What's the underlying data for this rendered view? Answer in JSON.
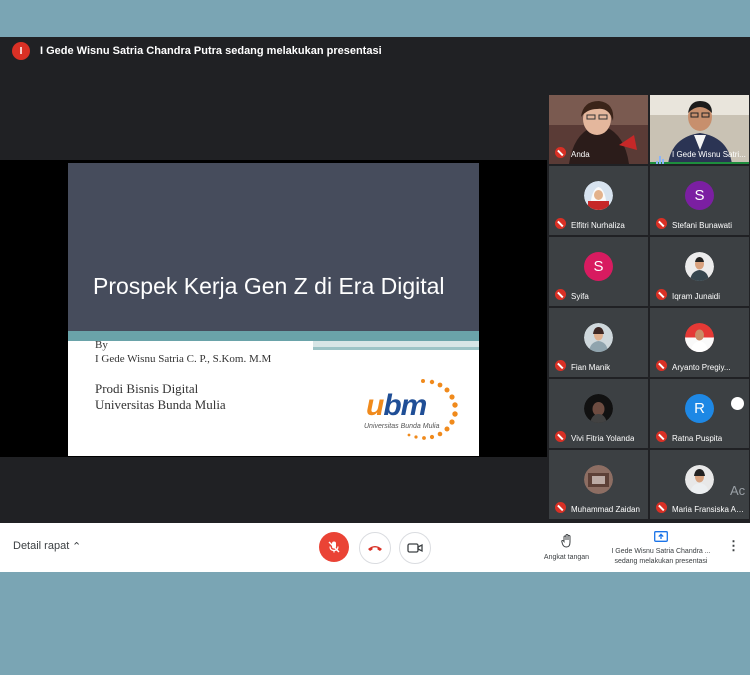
{
  "header": {
    "avatar_initial": "I",
    "presenting_text": "I Gede Wisnu Satria Chandra Putra sedang melakukan presentasi"
  },
  "slide": {
    "title": "Prospek Kerja Gen Z di Era Digital",
    "by": "By",
    "author": "I Gede Wisnu Satria C. P., S.Kom. M.M",
    "prodi": "Prodi Bisnis Digital",
    "university": "Universitas Bunda Mulia",
    "logo_text_u": "u",
    "logo_text_bm": "bm",
    "logo_subtitle": "Universitas Bunda Mulia"
  },
  "participants": [
    {
      "name": "Anda"
    },
    {
      "name": "I Gede Wisnu Satri..."
    },
    {
      "name": "Elfitri Nurhaliza"
    },
    {
      "name": "Stefani Bunawati",
      "initial": "S",
      "color": "#7b1fa2"
    },
    {
      "name": "Syifa",
      "initial": "S",
      "color": "#d81b60"
    },
    {
      "name": "Iqram Junaidi"
    },
    {
      "name": "Fian Manik"
    },
    {
      "name": "Aryanto Pregiy..."
    },
    {
      "name": "Vivi Fitria Yolanda"
    },
    {
      "name": "Ratna Puspita",
      "initial": "R",
      "color": "#1e88e5"
    },
    {
      "name": "Muhammad Zaidan"
    },
    {
      "name": "Maria Fransiska Ap..."
    }
  ],
  "overlay": {
    "activate": "Ac"
  },
  "bottom_bar": {
    "details_label": "Detail rapat",
    "raise_hand_label": "Angkat tangan",
    "presenting_line1": "I Gede Wisnu Satria Chandra ...",
    "presenting_line2": "sedang melakukan presentasi"
  }
}
